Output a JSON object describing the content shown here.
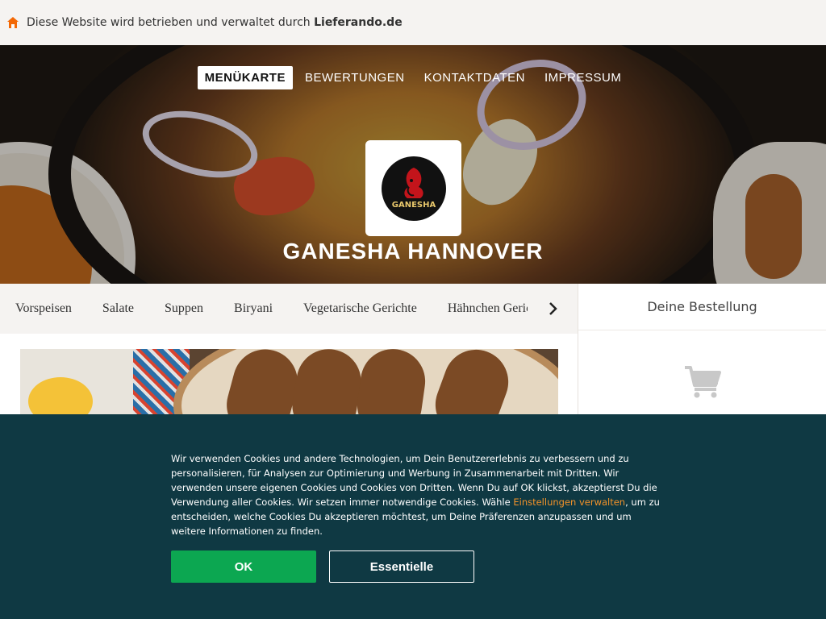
{
  "topbar": {
    "notice_prefix": "Diese Website wird betrieben und verwaltet durch ",
    "notice_brand": "Lieferando.de",
    "icon": "home-icon"
  },
  "nav": {
    "items": [
      "MENÜKARTE",
      "BEWERTUNGEN",
      "KONTAKTDATEN",
      "IMPRESSUM"
    ],
    "active": "MENÜKARTE"
  },
  "restaurant": {
    "name": "GANESHA HANNOVER",
    "logo_text": "GANESHA"
  },
  "categories": {
    "items": [
      "Vorspeisen",
      "Salate",
      "Suppen",
      "Biryani",
      "Vegetarische Gerichte",
      "Hähnchen Gerichte"
    ],
    "next_icon": "chevron-right-icon"
  },
  "order": {
    "title": "Deine Bestellung",
    "icon": "cart-icon"
  },
  "cookie": {
    "text_part1": "Wir verwenden Cookies und andere Technologien, um Dein Benutzererlebnis zu verbessern und zu personalisieren, für Analysen zur Optimierung und Werbung in Zusammenarbeit mit Dritten. Wir verwenden unsere eigenen Cookies und Cookies von Dritten. Wenn Du auf OK klickst, akzeptierst Du die Verwendung aller Cookies. Wir setzen immer notwendige Cookies. Wähle ",
    "link": "Einstellungen verwalten",
    "text_part2": ", um zu entscheiden, welche Cookies Du akzeptieren möchtest, um Deine Präferenzen anzupassen und um weitere Informationen zu finden.",
    "ok_label": "OK",
    "essential_label": "Essentielle"
  },
  "colors": {
    "accent": "#f36805",
    "cookie_bg": "#0f3943",
    "ok_green": "#0ca751",
    "link_orange": "#f39229"
  }
}
